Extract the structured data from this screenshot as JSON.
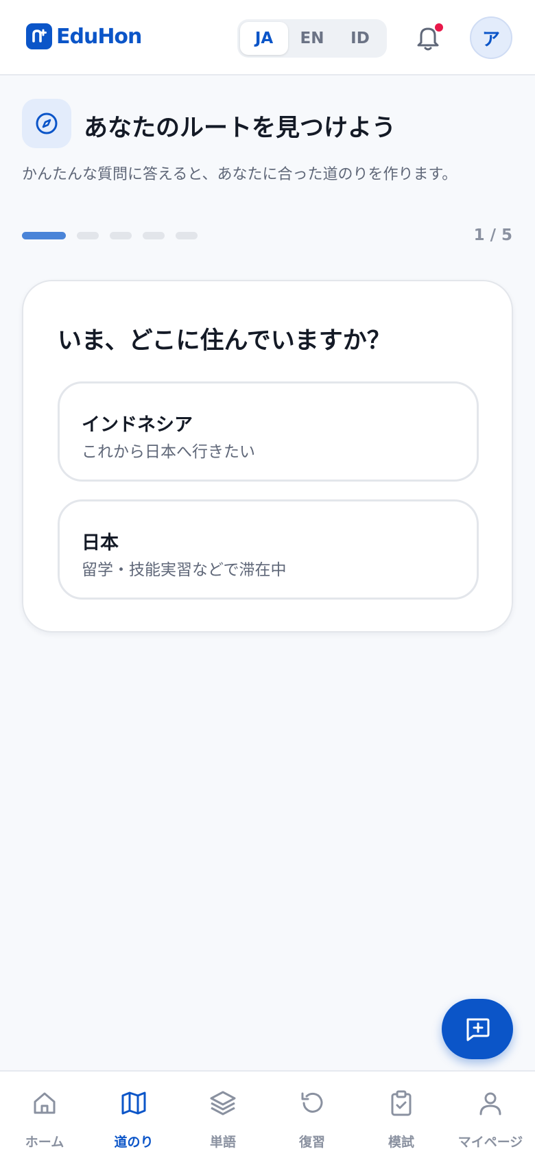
{
  "header": {
    "logo_text": "EduHon",
    "languages": [
      "JA",
      "EN",
      "ID"
    ],
    "active_language": "JA",
    "avatar_initial": "ア",
    "has_notification": true
  },
  "page": {
    "title": "あなたのルートを見つけよう",
    "subtitle": "かんたんな質問に答えると、あなたに合った道のりを作ります。",
    "progress": {
      "current": 1,
      "total": 5,
      "label": "1 / 5"
    }
  },
  "question": {
    "text": "いま、どこに住んでいますか？",
    "options": [
      {
        "title": "インドネシア",
        "description": "これから日本へ行きたい"
      },
      {
        "title": "日本",
        "description": "留学・技能実習などで滞在中"
      }
    ]
  },
  "bottom_nav": {
    "items": [
      {
        "label": "ホーム",
        "icon": "home-icon"
      },
      {
        "label": "道のり",
        "icon": "map-icon"
      },
      {
        "label": "単語",
        "icon": "layers-icon"
      },
      {
        "label": "復習",
        "icon": "rotate-ccw-icon"
      },
      {
        "label": "模試",
        "icon": "clipboard-check-icon"
      },
      {
        "label": "マイページ",
        "icon": "user-icon"
      }
    ],
    "active_index": 1
  },
  "colors": {
    "primary": "#0b55c8",
    "progress_done": "#4a84d8",
    "notification_dot": "#e8184a",
    "muted_text": "#8a91a0",
    "background": "#f7f9fc"
  }
}
